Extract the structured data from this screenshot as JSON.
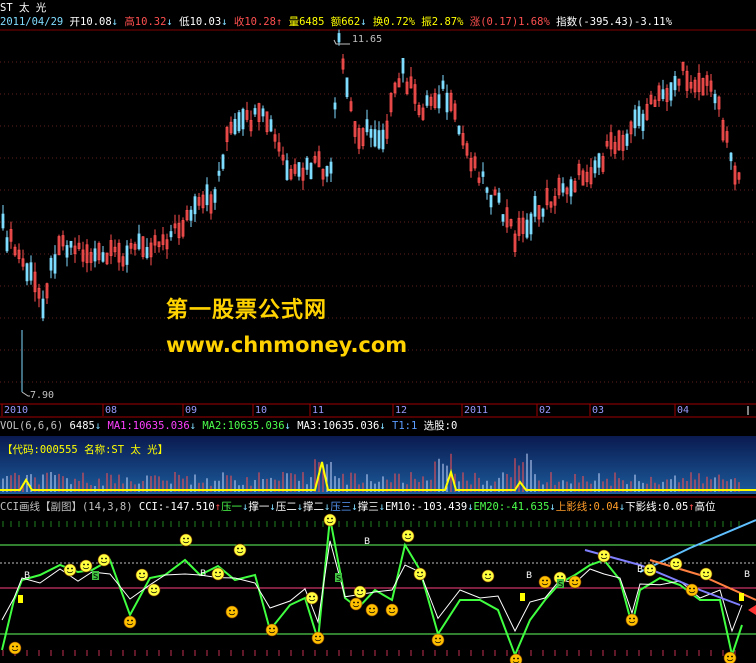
{
  "header": {
    "stock": "ST 太 光",
    "date": "2011/04/29",
    "open": "开10.08",
    "high": "高10.32",
    "low": "低10.03",
    "close": "收10.28",
    "volume": "量6485",
    "amount": "额662",
    "turnover": "换0.72%",
    "amplitude": "振2.87%",
    "change": "涨(0.17)1.68%",
    "index": "指数(-395.43)-3.11%"
  },
  "price_chart": {
    "max_label": "11.65",
    "min_label": "7.90",
    "up_color": "#ff5050",
    "down_color": "#7fdcff",
    "x_ticks": [
      "2010",
      "08",
      "09",
      "10",
      "11",
      "12",
      "2011",
      "02",
      "03",
      "04"
    ]
  },
  "watermark": {
    "line1": "第一股票公式网",
    "line2": "www.chnmoney.com"
  },
  "volume_panel": {
    "title": "VOL(6,6,6)",
    "vol": "6485",
    "ma1": "MA1:10635.036",
    "ma2": "MA2:10635.036",
    "ma3": "MA3:10635.036",
    "t1": "T1:1",
    "select": "选股:0",
    "code_label": "【代码:000555 名称:ST 太 光】"
  },
  "cci_panel": {
    "title": "CCI画线【副图】",
    "params": "(14,3,8)",
    "cci": "CCI:-147.510",
    "y1": "压一",
    "c1": "撑一",
    "y2": "压二",
    "c2": "撑二",
    "y3": "压三",
    "c3": "撑三",
    "em10": "EM10:-103.439",
    "em20": "EM20:-41.635",
    "upper": "上影线:0.04",
    "lower": "下影线:0.05",
    "high": "高位",
    "mark_b": "B",
    "mark_s": "S"
  }
}
